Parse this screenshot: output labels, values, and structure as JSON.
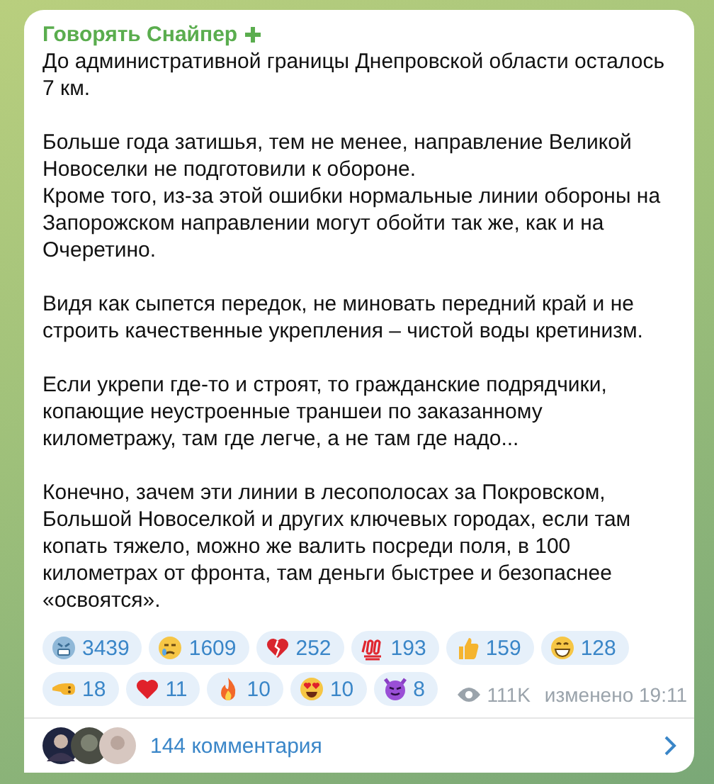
{
  "post": {
    "channel": "Говорять Снайпер",
    "paragraphs": [
      "До административной границы Днепровской области осталось\n7 км.",
      "Больше года затишья, тем не менее, направление Великой\nНовоселки не подготовили к обороне.\nКроме того, из-за этой ошибки нормальные линии обороны на\nЗапорожском направлении могут обойти так же, как и на\nОчеретино.",
      "Видя как сыпется передок, не миновать передний край и не\nстроить качественные укрепления – чистой воды кретинизм.",
      "Если укрепи где-то и строят, то гражданские подрядчики,\nкопающие неустроенные траншеи по заказанному\nкилометражу, там где легче, а не там где надо...",
      "Конечно, зачем эти линии в лесополосах за Покровском,\nБольшой Новоселкой и других ключевых городах, если там\nкопать тяжело, можно же валить посреди поля, в 100\nкилометрах от фронта, там деньги быстрее и безопаснее\n«освоятся»."
    ],
    "reactions": [
      {
        "kind": "scream",
        "count": "3439"
      },
      {
        "kind": "cry",
        "count": "1609"
      },
      {
        "kind": "broken-heart",
        "count": "252"
      },
      {
        "kind": "hundred",
        "count": "193"
      },
      {
        "kind": "thumbs-up",
        "count": "159"
      },
      {
        "kind": "grin",
        "count": "128"
      },
      {
        "kind": "pointing",
        "count": "18"
      },
      {
        "kind": "heart",
        "count": "11"
      },
      {
        "kind": "fire",
        "count": "10"
      },
      {
        "kind": "heart-eyes",
        "count": "10"
      },
      {
        "kind": "devil",
        "count": "8"
      }
    ],
    "views": "111K",
    "edited": "изменено 19:11",
    "comments": "144 комментария"
  }
}
